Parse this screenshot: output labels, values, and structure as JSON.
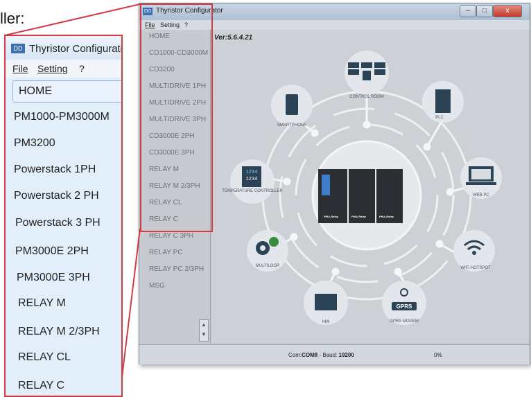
{
  "caption": "ller:",
  "window": {
    "title": "Thyristor Configurator",
    "menu": [
      "File",
      "Setting",
      "?"
    ],
    "version": "Ver:5.6.4.21",
    "left_items": [
      "HOME",
      "CD1000-CD3000M",
      "CD3200",
      "MULTIDRIVE 1PH",
      "MULTIDRIVE 2PH",
      "MULTIDRIVE 3PH",
      "CD3000E 2PH",
      "CD3000E 3PH",
      "RELAY M",
      "RELAY M 2/3PH",
      "RELAY CL",
      "RELAY C",
      "RELAY C 3PH",
      "RELAY PC",
      "RELAY PC 2/3PH",
      "MSG"
    ],
    "status": {
      "com_label": "Com:",
      "com_value": "COM8",
      "baud_label": " - Baud: ",
      "baud_value": "19200",
      "progress": "0%"
    },
    "buttons": {
      "minimize": "–",
      "maximize": "□",
      "close": "x"
    }
  },
  "zoom": {
    "title": "Thyristor Configurato",
    "menu": [
      "File",
      "Setting",
      "?"
    ],
    "home": "HOME",
    "items": [
      "PM1000-PM3000M",
      "PM3200",
      "Powerstack 1PH",
      "Powerstack 2 PH",
      "Powerstack 3 PH",
      "PM3000E  2PH",
      "PM3000E   3PH",
      "RELAY M",
      "RELAY M 2/3PH",
      "RELAY CL",
      "RELAY C"
    ]
  },
  "diagram": {
    "nodes": [
      "CONTROL ROOM",
      "PLC",
      "WEB PC",
      "WIFI HOTSPOT",
      "GPRS MODEM",
      "HMI",
      "MULTILOOP",
      "TEMPERATURE CONTROLLER",
      "SMARTPHONE"
    ],
    "gprs_badge": "GPRS",
    "device_labels": [
      "PMA-Relay",
      "PMA-Relay",
      "PMA-Relay"
    ],
    "temp_display": [
      "1234",
      "1234"
    ]
  },
  "colors": {
    "accent": "#d43a44",
    "bg": "#cdd1d6"
  }
}
